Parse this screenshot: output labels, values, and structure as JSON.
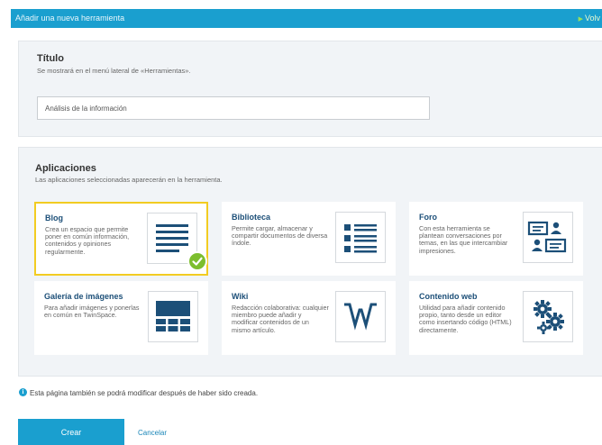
{
  "header": {
    "title": "Añadir una nueva herramienta",
    "back_label": "Volv"
  },
  "title_section": {
    "heading": "Título",
    "subtitle": "Se mostrará en el menú lateral de «Herramientas».",
    "input_value": "Análisis de la información"
  },
  "apps_section": {
    "heading": "Aplicaciones",
    "subtitle": "Las aplicaciones seleccionadas aparecerán en la herramienta.",
    "cards": [
      {
        "name": "Blog",
        "desc": "Crea un espacio que permite poner en común información, contenidos y opiniones regularmente.",
        "icon": "blog-lines-icon",
        "selected": true
      },
      {
        "name": "Biblioteca",
        "desc": "Permite cargar, almacenar y compartir documentos de diversa índole.",
        "icon": "library-list-icon",
        "selected": false
      },
      {
        "name": "Foro",
        "desc": "Con esta herramienta se plantean conversaciones por temas, en las que intercambiar impresiones.",
        "icon": "forum-chat-icon",
        "selected": false
      },
      {
        "name": "Galería de imágenes",
        "desc": "Para añadir imágenes y ponerlas en común en TwinSpace.",
        "icon": "gallery-grid-icon",
        "selected": false
      },
      {
        "name": "Wiki",
        "desc": "Redacción colaborativa: cualquier miembro puede añadir y modificar contenidos de un mismo artículo.",
        "icon": "wiki-w-icon",
        "selected": false
      },
      {
        "name": "Contenido web",
        "desc": "Utilidad para añadir contenido propio, tanto desde un editor como insertando código (HTML) directamente.",
        "icon": "gears-icon",
        "selected": false
      }
    ]
  },
  "info": {
    "text": "Esta página también se podrá modificar después de haber sido creada."
  },
  "actions": {
    "create_label": "Crear",
    "cancel_label": "Cancelar"
  },
  "colors": {
    "primary": "#1a9fcf",
    "icon_dark": "#1c4f78",
    "selected_border": "#f2cc22",
    "check": "#7cbe2e"
  }
}
